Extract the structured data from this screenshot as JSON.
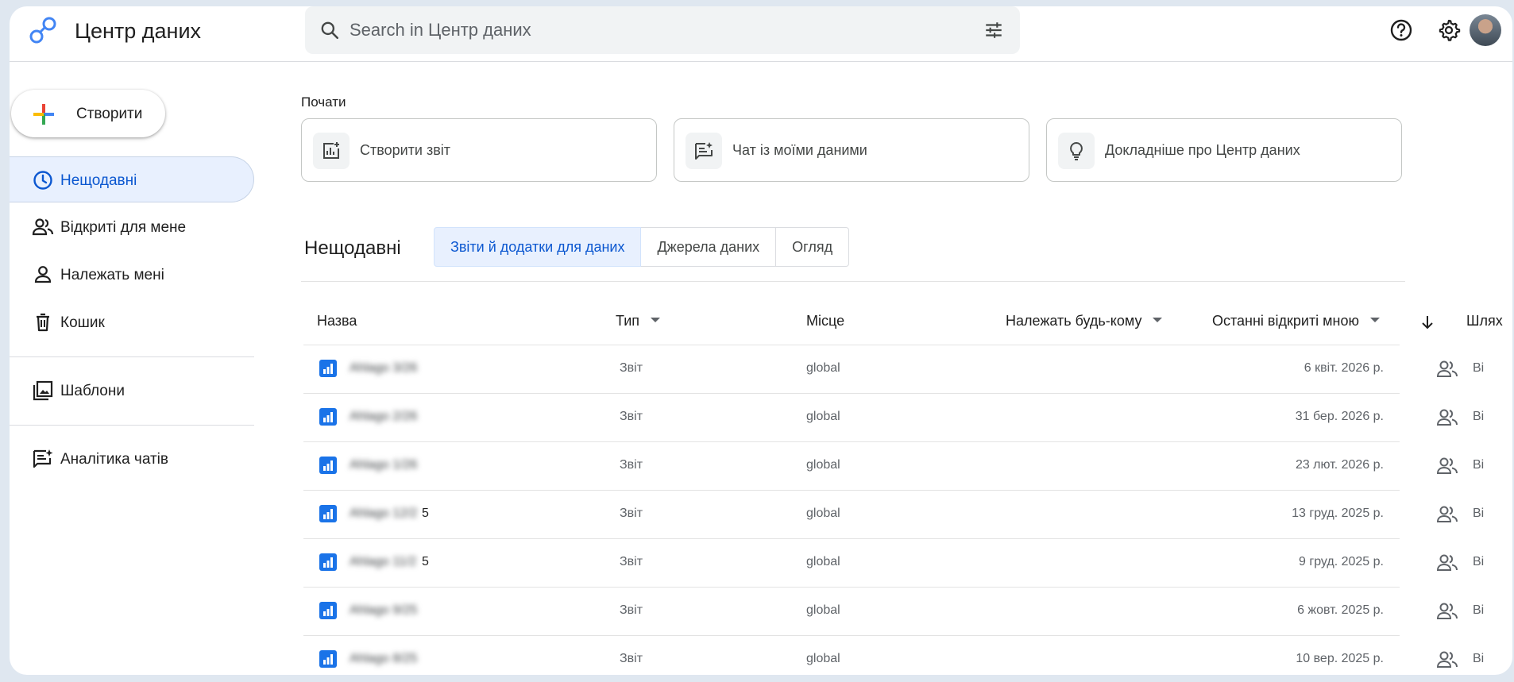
{
  "app": {
    "title": "Центр даних"
  },
  "search": {
    "placeholder": "Search in Центр даних"
  },
  "sidebar": {
    "create_label": "Створити",
    "items": [
      {
        "label": "Нещодавні",
        "icon": "clock-icon",
        "active": true
      },
      {
        "label": "Відкриті для мене",
        "icon": "people-icon",
        "active": false
      },
      {
        "label": "Належать мені",
        "icon": "person-icon",
        "active": false
      },
      {
        "label": "Кошик",
        "icon": "trash-icon",
        "active": false
      },
      {
        "label": "Шаблони",
        "icon": "templates-icon",
        "active": false
      },
      {
        "label": "Аналітика чатів",
        "icon": "chat-analytics-icon",
        "active": false
      }
    ]
  },
  "start": {
    "label": "Почати",
    "cards": [
      {
        "label": "Створити звіт",
        "icon": "add-chart-icon"
      },
      {
        "label": "Чат із моїми даними",
        "icon": "chat-spark-icon"
      },
      {
        "label": "Докладніше про Центр даних",
        "icon": "lightbulb-icon"
      }
    ]
  },
  "recent": {
    "title": "Нещодавні",
    "tabs": [
      "Звіти й додатки для даних",
      "Джерела даних",
      "Огляд"
    ],
    "active_tab": 0
  },
  "table": {
    "headers": {
      "name": "Назва",
      "type": "Тип",
      "location": "Місце",
      "owner": "Належать будь-кому",
      "last_opened": "Останні відкриті мною",
      "path": "Шлях"
    },
    "rows": [
      {
        "name": "Ahlago 3/26",
        "tail": "",
        "type": "Звіт",
        "location": "global",
        "date": "6 квіт. 2026 р.",
        "path": "Ві"
      },
      {
        "name": "Ahlago 2/26",
        "tail": "",
        "type": "Звіт",
        "location": "global",
        "date": "31 бер. 2026 р.",
        "path": "Ві"
      },
      {
        "name": "Ahlago 1/26",
        "tail": "",
        "type": "Звіт",
        "location": "global",
        "date": "23 лют. 2026 р.",
        "path": "Ві"
      },
      {
        "name": "Ahlago 12/2",
        "tail": "5",
        "type": "Звіт",
        "location": "global",
        "date": "13 груд. 2025 р.",
        "path": "Ві"
      },
      {
        "name": "Ahlago 11/2",
        "tail": "5",
        "type": "Звіт",
        "location": "global",
        "date": "9 груд. 2025 р.",
        "path": "Ві"
      },
      {
        "name": "Ahlago 9/25",
        "tail": "",
        "type": "Звіт",
        "location": "global",
        "date": "6 жовт. 2025 р.",
        "path": "Ві"
      },
      {
        "name": "Ahlago 8/25",
        "tail": "",
        "type": "Звіт",
        "location": "global",
        "date": "10 вер. 2025 р.",
        "path": "Ві"
      }
    ]
  }
}
